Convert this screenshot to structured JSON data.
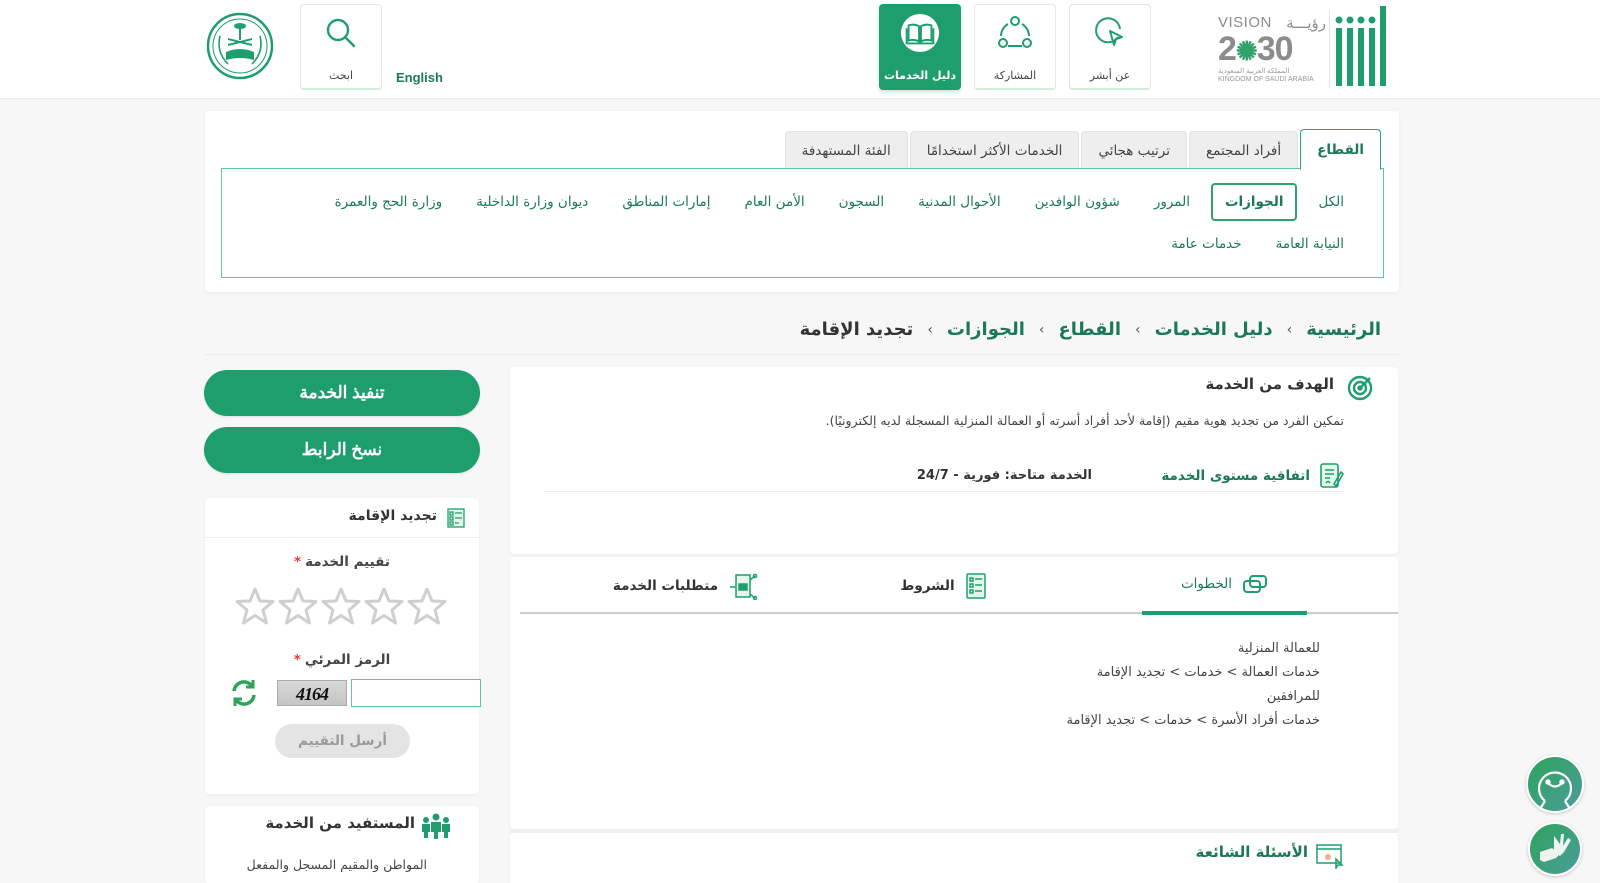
{
  "header": {
    "logos": {
      "absher": "absher-logo",
      "vision": {
        "top_en": "VISION",
        "top_ar": "رؤيـــة",
        "year": "2030",
        "sub_ar": "المملكة العربية السعودية",
        "sub_en": "KINGDOM OF SAUDI ARABIA"
      },
      "moi": "ministry-of-interior-emblem"
    },
    "nav": [
      {
        "label": "عن أبشر",
        "icon": "cursor-pointer-icon",
        "active": false
      },
      {
        "label": "المشاركة",
        "icon": "share-nodes-icon",
        "active": false
      },
      {
        "label": "دليل الخدمات",
        "icon": "book-icon",
        "active": true
      }
    ],
    "search_label": "ابحث",
    "language_link": "English"
  },
  "filters": {
    "tabs": [
      {
        "label": "القطاع",
        "active": true
      },
      {
        "label": "أفراد المجتمع",
        "active": false
      },
      {
        "label": "ترتيب هجائي",
        "active": false
      },
      {
        "label": "الخدمات الأكثر استخدامًا",
        "active": false
      },
      {
        "label": "الفئة المستهدفة",
        "active": false
      }
    ],
    "sectors_row1": [
      {
        "label": "الكل",
        "active": false
      },
      {
        "label": "الجوازات",
        "active": true
      },
      {
        "label": "المرور",
        "active": false
      },
      {
        "label": "شؤون الوافدين",
        "active": false
      },
      {
        "label": "الأحوال المدنية",
        "active": false
      },
      {
        "label": "السجون",
        "active": false
      },
      {
        "label": "الأمن العام",
        "active": false
      },
      {
        "label": "إمارات المناطق",
        "active": false
      },
      {
        "label": "ديوان وزارة الداخلية",
        "active": false
      },
      {
        "label": "وزارة الحج والعمرة",
        "active": false
      }
    ],
    "sectors_row2": [
      {
        "label": "النيابة العامة",
        "active": false
      },
      {
        "label": "خدمات عامة",
        "active": false
      }
    ]
  },
  "breadcrumb": {
    "items": [
      "الرئيسية",
      "دليل الخدمات",
      "القطاع",
      "الجوازات",
      "تجديد الإقامة"
    ],
    "separator": "›"
  },
  "goal": {
    "title": "الهدف من الخدمة",
    "text": "تمكين الفرد من تجديد هوية مقيم (إقامة لأحد أفراد أسرته أو العمالة المنزلية المسجلة لديه إلكترونيًا).",
    "sla_label": "اتفاقية مستوى الخدمة",
    "sla_value": "الخدمة متاحة: فورية - 24/7"
  },
  "details_tabs": [
    {
      "label": "الخطوات",
      "icon": "steps-icon",
      "active": true
    },
    {
      "label": "الشروط",
      "icon": "conditions-icon",
      "active": false
    },
    {
      "label": "متطلبات الخدمة",
      "icon": "requirements-icon",
      "active": false
    }
  ],
  "steps": [
    "للعمالة المنزلية",
    "خدمات العمالة > خدمات > تجديد الإقامة",
    "للمرافقين",
    "خدمات أفراد الأسرة > خدمات > تجديد الإقامة"
  ],
  "faq": {
    "title": "الأسئلة الشائعة"
  },
  "sidebar": {
    "execute_button": "تنفيذ الخدمة",
    "copy_link_button": "نسخ الرابط",
    "rating": {
      "title": "تجديد الإقامة",
      "rating_label": "تقييم الخدمة",
      "required_mark": "*",
      "stars_total": 5,
      "stars_selected": 0,
      "captcha_label": "الرمز المرئي",
      "captcha_code": "4164",
      "captcha_value": "",
      "submit_button": "أرسل التقييم"
    },
    "beneficiary": {
      "title": "المستفيد من الخدمة",
      "text": "المواطن والمقيم المسجل والمفعل"
    }
  },
  "floating": [
    {
      "name": "virtual-assistant",
      "icon": "assistant-face-icon"
    },
    {
      "name": "sign-language",
      "icon": "sign-language-hands-icon"
    }
  ],
  "colors": {
    "primary": "#1f9e6d",
    "primary_dark": "#1b7a55",
    "border_light_green": "#63c49b",
    "required": "#e53935"
  }
}
